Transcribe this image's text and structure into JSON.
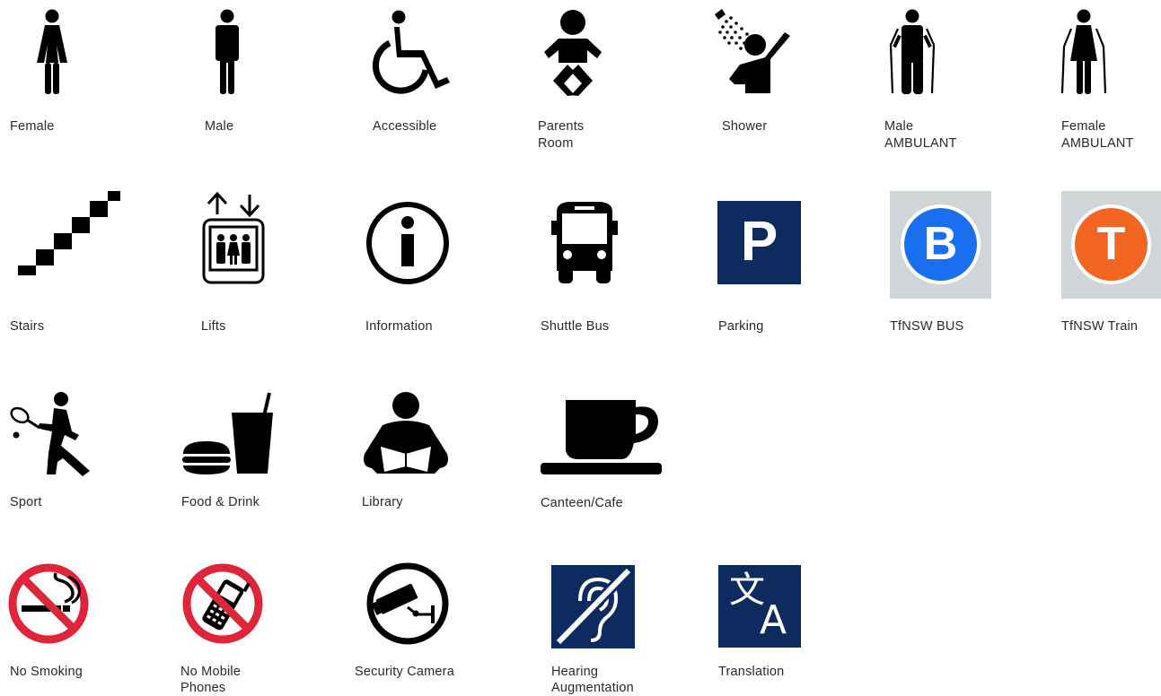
{
  "colors": {
    "icon": "#000000",
    "parking_bg": "#0d2b5e",
    "bus_grey": "#d0d6d8",
    "bus_blue": "#1a6ff0",
    "train_orange": "#f26522",
    "prohibit_red": "#e0253a",
    "hearing_bg": "#0d2b5e",
    "translation_bg": "#0d2b5e"
  },
  "signs": [
    {
      "label": "Female",
      "icon": "female-person-icon"
    },
    {
      "label": "Male",
      "icon": "male-person-icon"
    },
    {
      "label": "Accessible",
      "icon": "wheelchair-icon"
    },
    {
      "label_lines": [
        "Parents",
        "Room"
      ],
      "icon": "baby-icon"
    },
    {
      "label": "Shower",
      "icon": "shower-icon"
    },
    {
      "label_lines": [
        "Male",
        "AMBULANT"
      ],
      "icon": "male-crutches-icon"
    },
    {
      "label_lines": [
        "Female",
        "AMBULANT"
      ],
      "icon": "female-crutches-icon"
    },
    {
      "label": "Stairs",
      "icon": "stairs-icon"
    },
    {
      "label": "Lifts",
      "icon": "lift-icon"
    },
    {
      "label": "Information",
      "icon": "information-icon"
    },
    {
      "label": "Shuttle Bus",
      "icon": "bus-icon"
    },
    {
      "label": "Parking",
      "icon": "parking-icon",
      "glyph": "P"
    },
    {
      "label": "TfNSW BUS",
      "icon": "tfnsw-bus-icon",
      "glyph": "B"
    },
    {
      "label": "TfNSW Train",
      "icon": "tfnsw-train-icon",
      "glyph": "T"
    },
    {
      "label": "Sport",
      "icon": "tennis-player-icon"
    },
    {
      "label": "Food & Drink",
      "icon": "burger-drink-icon"
    },
    {
      "label": "Library",
      "icon": "reader-icon"
    },
    {
      "label": "Canteen/Cafe",
      "icon": "coffee-cup-icon"
    },
    {
      "label": "No Smoking",
      "icon": "no-smoking-icon"
    },
    {
      "label_lines": [
        "No Mobile",
        "Phones"
      ],
      "icon": "no-mobile-phone-icon"
    },
    {
      "label": "Security Camera",
      "icon": "security-camera-icon"
    },
    {
      "label_lines": [
        "Hearing",
        "Augmentation"
      ],
      "icon": "hearing-loop-icon"
    },
    {
      "label": "Translation",
      "icon": "translation-icon",
      "glyph_1": "文",
      "glyph_2": "A"
    }
  ]
}
